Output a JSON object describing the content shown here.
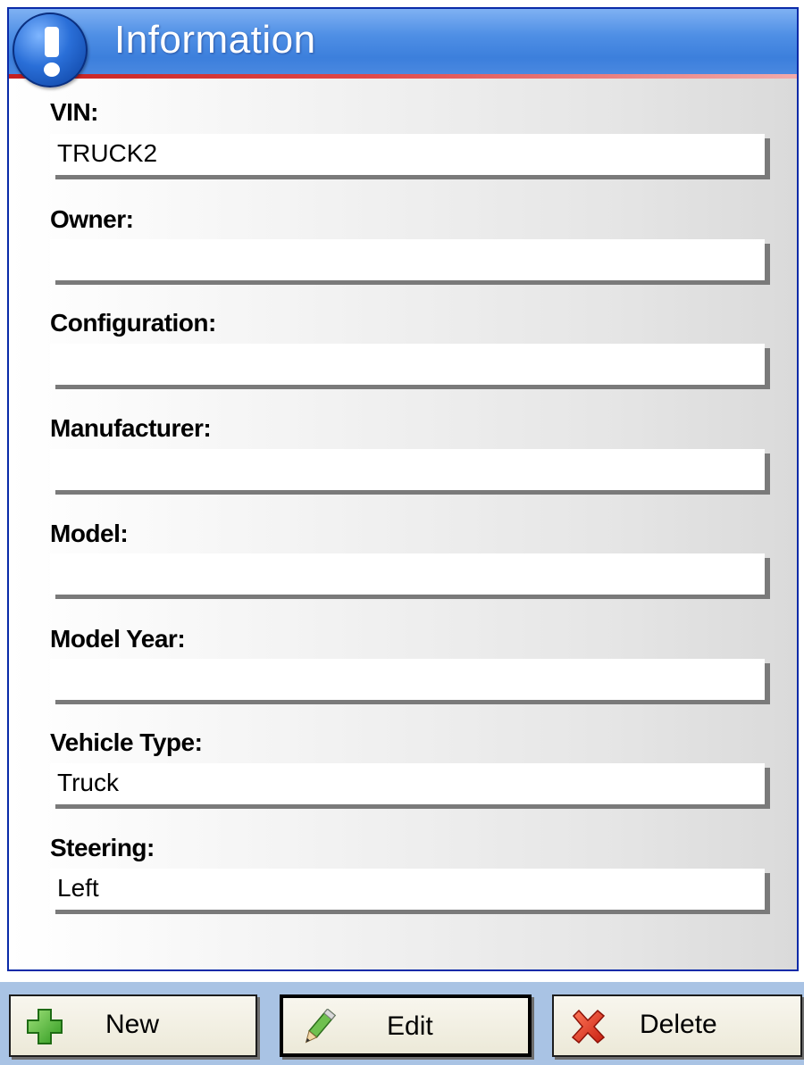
{
  "panel": {
    "title": "Information"
  },
  "fields": [
    {
      "label": "VIN:",
      "value": "TRUCK2"
    },
    {
      "label": "Owner:",
      "value": ""
    },
    {
      "label": "Configuration:",
      "value": ""
    },
    {
      "label": "Manufacturer:",
      "value": ""
    },
    {
      "label": "Model:",
      "value": ""
    },
    {
      "label": "Model Year:",
      "value": ""
    },
    {
      "label": "Vehicle Type:",
      "value": "Truck"
    },
    {
      "label": "Steering:",
      "value": "Left"
    }
  ],
  "buttons": {
    "new_label": "New",
    "edit_label": "Edit",
    "delete_label": "Delete"
  },
  "colors": {
    "header_blue": "#3c7fdc",
    "header_red_line": "#d83434",
    "panel_border": "#0a2aa8",
    "button_strip": "#a9c3e4"
  },
  "icons": {
    "header": "info-exclamation-icon",
    "new": "green-plus-icon",
    "edit": "pencil-icon",
    "delete": "red-x-icon"
  }
}
